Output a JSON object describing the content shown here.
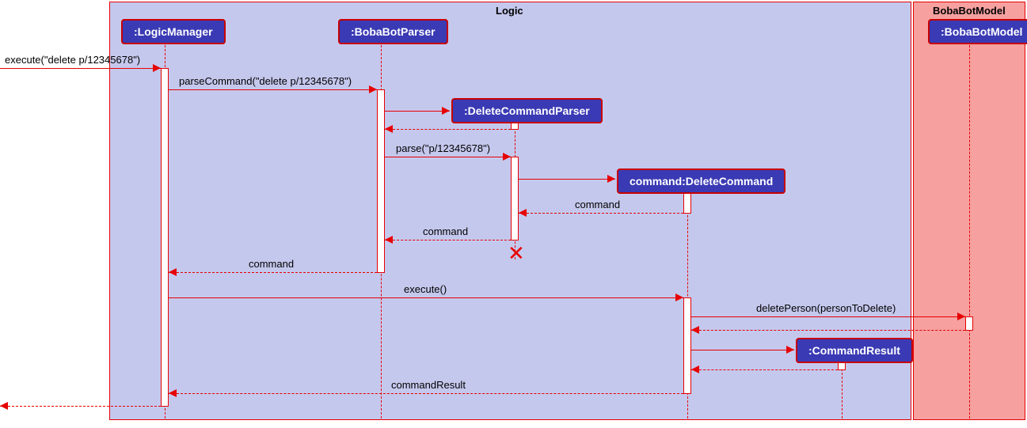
{
  "diagram_type": "sequence",
  "containers": {
    "logic": {
      "label": "Logic"
    },
    "model": {
      "label": "BobaBotModel"
    }
  },
  "participants": {
    "logicManager": ":LogicManager",
    "bobaBotParser": ":BobaBotParser",
    "deleteCommandParser": ":DeleteCommandParser",
    "deleteCommand": "command:DeleteCommand",
    "bobaBotModel": ":BobaBotModel",
    "commandResult": ":CommandResult"
  },
  "messages": {
    "m1": "execute(\"delete p/12345678\")",
    "m2": "parseCommand(\"delete p/12345678\")",
    "m3": "parse(\"p/12345678\")",
    "m4": "command",
    "m5": "command",
    "m6": "command",
    "m7": "execute()",
    "m8": "deletePerson(personToDelete)",
    "m9": "commandResult"
  }
}
